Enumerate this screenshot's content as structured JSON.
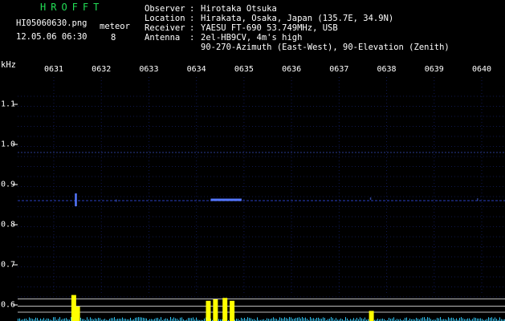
{
  "header": {
    "app_title": "HROFFT",
    "file_name": "HI05060630.png",
    "timestamp": "12.05.06 06:30",
    "meteor_label": "meteor",
    "meteor_count": "8"
  },
  "info": [
    {
      "key": "Observer",
      "sep": ":",
      "value": "Hirotaka Otsuka"
    },
    {
      "key": "Location",
      "sep": ":",
      "value": "Hirakata, Osaka, Japan (135.7E, 34.9N)"
    },
    {
      "key": "Receiver",
      "sep": ":",
      "value": "YAESU FT-690 53.749MHz, USB"
    },
    {
      "key": "Antenna",
      "sep": ":",
      "value": "2el-HB9CV, 4m's high"
    },
    {
      "key": "",
      "sep": "",
      "value": "90-270-Azimuth (East-West), 90-Elevation (Zenith)"
    }
  ],
  "colors": {
    "background": "#000000",
    "title_green": "#22dd55",
    "grid": "#101850",
    "echo": "#5577ff",
    "spectrum": "#33ccff",
    "spike": "#ffff00",
    "threshold_line": "#bbbbbb"
  },
  "chart_data": {
    "type": "heatmap",
    "unit_label": "kHz",
    "time_ticks": [
      "0631",
      "0632",
      "0633",
      "0634",
      "0635",
      "0636",
      "0637",
      "0638",
      "0639",
      "0640"
    ],
    "freq_ticks": [
      "1.1",
      "1.0",
      "0.9",
      "0.8",
      "0.7",
      "0.6"
    ],
    "freq_tick_values": [
      1.1,
      1.0,
      0.9,
      0.8,
      0.7,
      0.6
    ],
    "time_range_min": [
      30.5,
      40.5
    ],
    "freq_range_khz": [
      0.58,
      1.13
    ],
    "carrier_khz": 0.86,
    "noise_band_khz": 0.98,
    "echoes": [
      {
        "time_min": 31.46,
        "freq_khz": 0.86,
        "duration_min": 0.02,
        "strength": 0.9
      },
      {
        "time_min": 32.3,
        "freq_khz": 0.86,
        "duration_min": 0.01,
        "strength": 0.3
      },
      {
        "time_min": 34.3,
        "freq_khz": 0.862,
        "duration_min": 0.65,
        "strength": 1.0
      },
      {
        "time_min": 37.65,
        "freq_khz": 0.865,
        "duration_min": 0.01,
        "strength": 0.4
      },
      {
        "time_min": 39.9,
        "freq_khz": 0.863,
        "duration_min": 0.01,
        "strength": 0.3
      }
    ],
    "spikes": [
      {
        "time_min": 31.42,
        "level": 0.9
      },
      {
        "time_min": 31.5,
        "level": 0.5
      },
      {
        "time_min": 34.25,
        "level": 0.7
      },
      {
        "time_min": 34.4,
        "level": 0.75
      },
      {
        "time_min": 34.6,
        "level": 0.8
      },
      {
        "time_min": 34.75,
        "level": 0.7
      },
      {
        "time_min": 37.68,
        "level": 0.35
      }
    ],
    "threshold_levels": [
      0.3,
      0.55,
      0.85
    ]
  }
}
